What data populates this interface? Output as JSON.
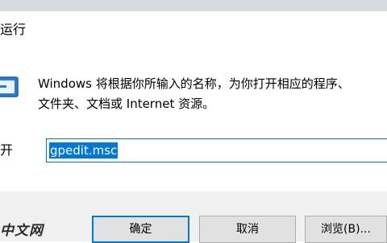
{
  "window": {
    "title": "运行"
  },
  "dialog": {
    "description_line1": "Windows 将根据你所输入的名称，为你打开相应的程序、",
    "description_line2": "文件夹、文档或 Internet 资源。",
    "open_label": "开",
    "input_value": "gpedit.msc"
  },
  "buttons": {
    "ok": "确定",
    "cancel": "取消",
    "browse": "浏览(B)..."
  },
  "watermark": "中文网",
  "colors": {
    "accent": "#0078d7",
    "footer": "#f0f0f0"
  }
}
